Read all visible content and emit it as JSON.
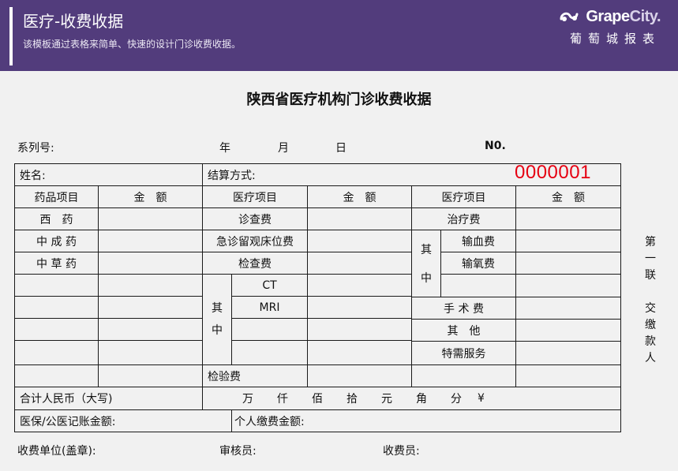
{
  "header": {
    "title": "医疗-收费收据",
    "subtitle": "该模板通过表格来简单、快速的设计门诊收费收据。",
    "brand_en_grape": "Grape",
    "brand_en_city": "City.",
    "brand_cn": "葡萄城报表"
  },
  "document": {
    "title": "陕西省医疗机构门诊收费收据",
    "serial_label": "系列号:",
    "year": "年",
    "month": "月",
    "day": "日",
    "no_label": "N0.",
    "receipt_number": "0000001"
  },
  "table": {
    "name_label": "姓名:",
    "payment_method_label": "结算方式:",
    "headers": [
      "药品项目",
      "金　额",
      "医疗项目",
      "金　额",
      "医疗项目",
      "金　额"
    ],
    "drugs": [
      "西　药",
      "中 成 药",
      "中 草 药"
    ],
    "medical_items": [
      "诊查费",
      "急诊留观床位费",
      "检查费"
    ],
    "exam_sub_label": [
      "其",
      "中"
    ],
    "exam_sub_items": [
      "CT",
      "MRI"
    ],
    "lab_fee": "检验费",
    "treatment_fee": "治疗费",
    "treatment_sub_label": [
      "其",
      "中"
    ],
    "treatment_sub_items": [
      "输血费",
      "输氧费"
    ],
    "other_items": [
      "手 术 费",
      "其　他",
      "特需服务"
    ],
    "total_label": "合计人民币（大写)",
    "amount_units": [
      "万",
      "仟",
      "佰",
      "拾",
      "元",
      "角",
      "分",
      "¥"
    ],
    "insurance_label": "医保/公医记账金额:",
    "personal_label": "个人缴费金额:"
  },
  "side_note": [
    "第",
    "一",
    "联",
    "",
    "交",
    "缴",
    "款",
    "人"
  ],
  "footer": {
    "unit_label": "收费单位(盖章):",
    "reviewer_label": "审核员:",
    "cashier_label": "收费员:"
  },
  "colors": {
    "header_bg": "#523c7c",
    "page_bg": "#f1f1f1",
    "receipt_number": "#e60012"
  }
}
